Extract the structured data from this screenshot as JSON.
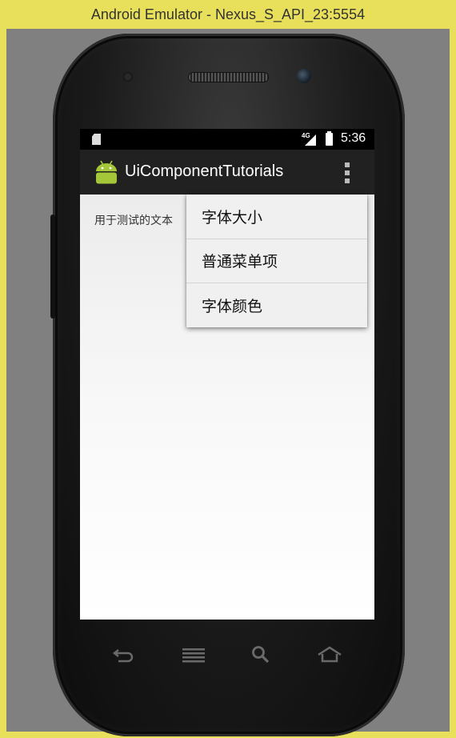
{
  "window": {
    "title": "Android Emulator - Nexus_S_API_23:5554"
  },
  "status_bar": {
    "network": "4G",
    "time": "5:36"
  },
  "action_bar": {
    "title": "UiComponentTutorials"
  },
  "content": {
    "text": "用于测试的文本"
  },
  "popup_menu": {
    "items": [
      {
        "label": "字体大小"
      },
      {
        "label": "普通菜单项"
      },
      {
        "label": "字体颜色"
      }
    ]
  },
  "nav_bar": {
    "icons": [
      "back-icon",
      "menu-icon",
      "search-icon",
      "home-icon"
    ]
  },
  "colors": {
    "frame": "#e8e05a",
    "action_bar": "#212121",
    "android_green": "#a4c639",
    "menu_bg": "#f0f0f0"
  }
}
